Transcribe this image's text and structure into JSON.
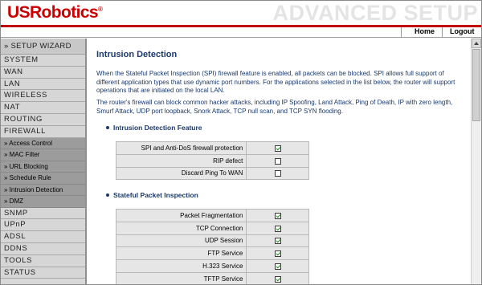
{
  "header": {
    "logo": "USRobotics",
    "logo_mark": "®",
    "banner": "ADVANCED SETUP"
  },
  "topnav": {
    "home": "Home",
    "logout": "Logout"
  },
  "sidebar": {
    "wizard": "» SETUP WIZARD",
    "items_top": [
      "SYSTEM",
      "WAN",
      "LAN",
      "WIRELESS",
      "NAT",
      "ROUTING",
      "FIREWALL"
    ],
    "subitems": [
      "» Access Control",
      "» MAC Filter",
      "» URL Blocking",
      "» Schedule Rule",
      "» Intrusion Detection",
      "» DMZ"
    ],
    "items_bottom": [
      "SNMP",
      "UPnP",
      "ADSL",
      "DDNS",
      "TOOLS",
      "STATUS"
    ]
  },
  "main": {
    "title": "Intrusion Detection",
    "para1": "When the Stateful Packet Inspection (SPI) firewall feature is enabled, all packets can be blocked.  SPI allows full support of different application types that use dynamic port numbers.  For the applications selected in the list below, the router will support operations that are initiated on the local LAN.",
    "para2": "The router's firewall can block common hacker attacks, including IP Spoofing, Land Attack, Ping of Death, IP with zero length, Smurf Attack, UDP port loopback, Snork Attack, TCP null scan, and TCP SYN flooding.",
    "section1": {
      "title": "Intrusion Detection Feature",
      "rows": [
        {
          "label": "SPI and Anti-DoS firewall protection",
          "checked": true
        },
        {
          "label": "RIP defect",
          "checked": false
        },
        {
          "label": "Discard Ping To WAN",
          "checked": false
        }
      ]
    },
    "section2": {
      "title": "Stateful Packet Inspection",
      "rows": [
        {
          "label": "Packet Fragmentation",
          "checked": true
        },
        {
          "label": "TCP Connection",
          "checked": true
        },
        {
          "label": "UDP Session",
          "checked": true
        },
        {
          "label": "FTP Service",
          "checked": true
        },
        {
          "label": "H.323 Service",
          "checked": true
        },
        {
          "label": "TFTP Service",
          "checked": true
        }
      ]
    }
  },
  "colors": {
    "brand_red": "#cc0000",
    "heading_blue": "#1b3a6b",
    "check_green": "#1c8c1c"
  }
}
